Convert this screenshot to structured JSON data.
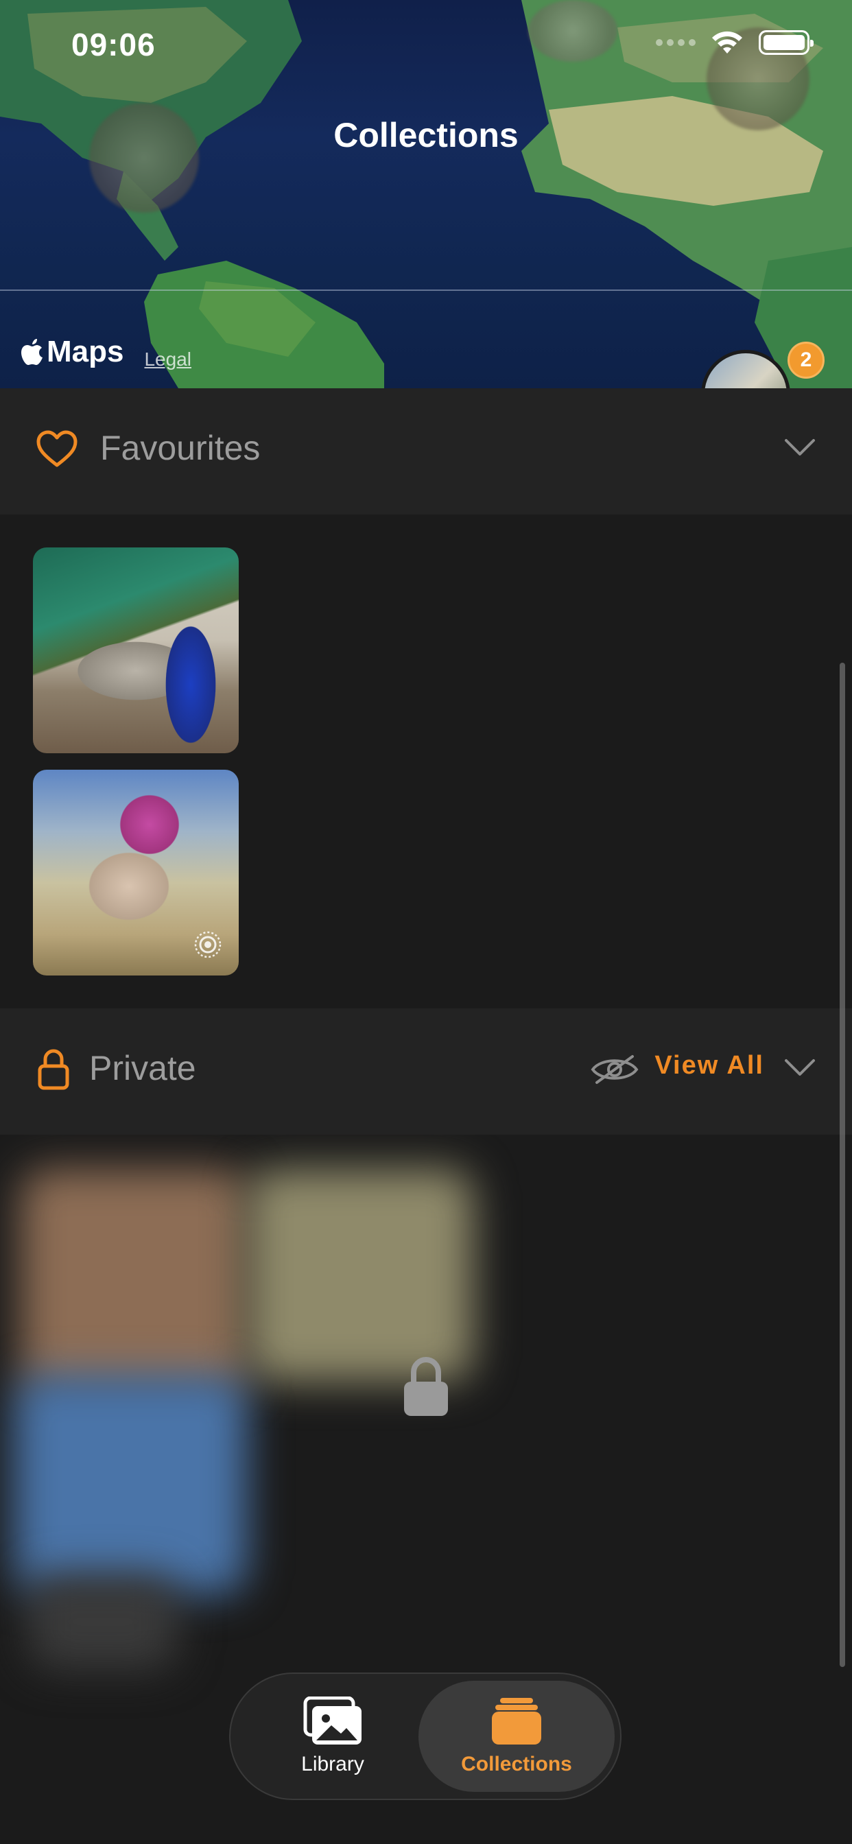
{
  "status_bar": {
    "time": "09:06"
  },
  "header": {
    "title": "Collections"
  },
  "map": {
    "brand": "Maps",
    "legal": "Legal",
    "cluster_count": "2"
  },
  "sections": {
    "favourites": {
      "title": "Favourites",
      "icon": "heart-icon"
    },
    "private": {
      "title": "Private",
      "view_all": "View All",
      "icon": "lock-icon"
    }
  },
  "tabbar": {
    "library": "Library",
    "collections": "Collections",
    "active": "collections"
  },
  "colors": {
    "accent": "#f08a24",
    "background": "#1b1b1b",
    "section_header": "#232323",
    "muted_text": "#9d9d9d"
  }
}
